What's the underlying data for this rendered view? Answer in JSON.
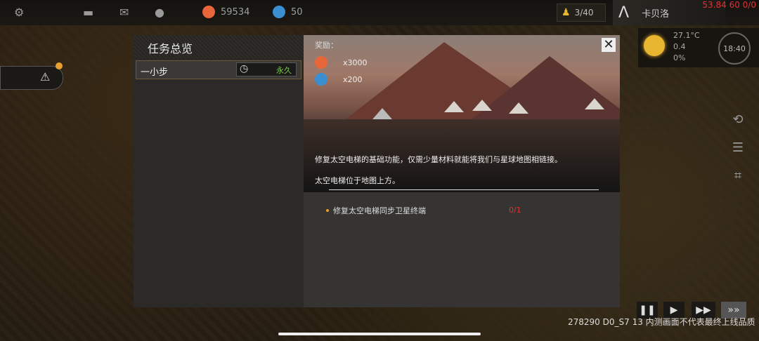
{
  "topbar": {
    "resource1": {
      "value": "59534",
      "color": "#e8663a",
      "icon": "food-icon"
    },
    "resource2": {
      "value": "50",
      "color": "#3a8fd0",
      "icon": "energy-icon"
    },
    "colonists": "3/40",
    "map_name": "卡贝洛",
    "debug": "53.84 60 0/0"
  },
  "weather": {
    "temperature": "27.1°C",
    "wind": "0.4",
    "light": "0%",
    "time": "18:40"
  },
  "dialog": {
    "title": "任务总览",
    "quest": {
      "name": "一小步",
      "duration": "永久"
    },
    "rewards_label": "奖励：",
    "rewards": [
      {
        "amount": "x3000",
        "icon": "food-icon",
        "color": "#e8663a"
      },
      {
        "amount": "x200",
        "icon": "energy-icon",
        "color": "#3a8fd0"
      }
    ],
    "description": "修复太空电梯的基础功能，仅需少量材料就能将我们与星球地图相链接。",
    "location": "太空电梯位于地图上方。",
    "objective": {
      "text": "修复太空电梯同步卫星终端",
      "progress": "0/1"
    }
  },
  "footer": {
    "build_text": "278290 D0_S7 13  内测画面不代表最终上线品质"
  }
}
